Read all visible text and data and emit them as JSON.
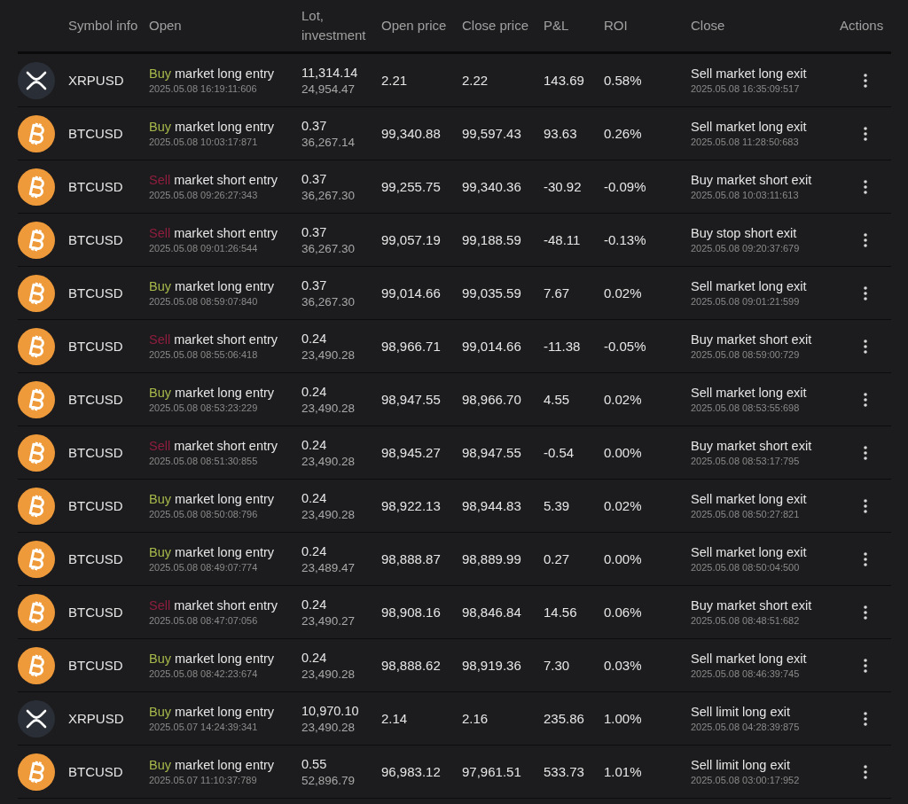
{
  "columns": [
    "Symbol info",
    "Open",
    "Lot, investment",
    "Open price",
    "Close price",
    "P&L",
    "ROI",
    "Close",
    "Actions"
  ],
  "rows": [
    {
      "kind": "xrp",
      "symbol": "XRPUSD",
      "side": {
        "label": "Buy",
        "kind": "buy"
      },
      "open_text": "market long entry",
      "open_time": "2025.05.08 16:19:11:606",
      "lot": "11,314.14",
      "investment": "24,954.47",
      "open_price": "2.21",
      "close_price": "2.22",
      "pnl": "143.69",
      "roi": "0.58%",
      "close_text": "Sell market long exit",
      "close_time": "2025.05.08 16:35:09:517"
    },
    {
      "kind": "btc",
      "symbol": "BTCUSD",
      "side": {
        "label": "Buy",
        "kind": "buy"
      },
      "open_text": "market long entry",
      "open_time": "2025.05.08 10:03:17:871",
      "lot": "0.37",
      "investment": "36,267.14",
      "open_price": "99,340.88",
      "close_price": "99,597.43",
      "pnl": "93.63",
      "roi": "0.26%",
      "close_text": "Sell market long exit",
      "close_time": "2025.05.08 11:28:50:683"
    },
    {
      "kind": "btc",
      "symbol": "BTCUSD",
      "side": {
        "label": "Sell",
        "kind": "sell"
      },
      "open_text": "market short entry",
      "open_time": "2025.05.08 09:26:27:343",
      "lot": "0.37",
      "investment": "36,267.30",
      "open_price": "99,255.75",
      "close_price": "99,340.36",
      "pnl": "-30.92",
      "roi": "-0.09%",
      "close_text": "Buy market short exit",
      "close_time": "2025.05.08 10:03:11:613"
    },
    {
      "kind": "btc",
      "symbol": "BTCUSD",
      "side": {
        "label": "Sell",
        "kind": "sell"
      },
      "open_text": "market short entry",
      "open_time": "2025.05.08 09:01:26:544",
      "lot": "0.37",
      "investment": "36,267.30",
      "open_price": "99,057.19",
      "close_price": "99,188.59",
      "pnl": "-48.11",
      "roi": "-0.13%",
      "close_text": "Buy stop short exit",
      "close_time": "2025.05.08 09:20:37:679"
    },
    {
      "kind": "btc",
      "symbol": "BTCUSD",
      "side": {
        "label": "Buy",
        "kind": "buy"
      },
      "open_text": "market long entry",
      "open_time": "2025.05.08 08:59:07:840",
      "lot": "0.37",
      "investment": "36,267.30",
      "open_price": "99,014.66",
      "close_price": "99,035.59",
      "pnl": "7.67",
      "roi": "0.02%",
      "close_text": "Sell market long exit",
      "close_time": "2025.05.08 09:01:21:599"
    },
    {
      "kind": "btc",
      "symbol": "BTCUSD",
      "side": {
        "label": "Sell",
        "kind": "sell"
      },
      "open_text": "market short entry",
      "open_time": "2025.05.08 08:55:06:418",
      "lot": "0.24",
      "investment": "23,490.28",
      "open_price": "98,966.71",
      "close_price": "99,014.66",
      "pnl": "-11.38",
      "roi": "-0.05%",
      "close_text": "Buy market short exit",
      "close_time": "2025.05.08 08:59:00:729"
    },
    {
      "kind": "btc",
      "symbol": "BTCUSD",
      "side": {
        "label": "Buy",
        "kind": "buy"
      },
      "open_text": "market long entry",
      "open_time": "2025.05.08 08:53:23:229",
      "lot": "0.24",
      "investment": "23,490.28",
      "open_price": "98,947.55",
      "close_price": "98,966.70",
      "pnl": "4.55",
      "roi": "0.02%",
      "close_text": "Sell market long exit",
      "close_time": "2025.05.08 08:53:55:698"
    },
    {
      "kind": "btc",
      "symbol": "BTCUSD",
      "side": {
        "label": "Sell",
        "kind": "sell"
      },
      "open_text": "market short entry",
      "open_time": "2025.05.08 08:51:30:855",
      "lot": "0.24",
      "investment": "23,490.28",
      "open_price": "98,945.27",
      "close_price": "98,947.55",
      "pnl": "-0.54",
      "roi": "0.00%",
      "close_text": "Buy market short exit",
      "close_time": "2025.05.08 08:53:17:795"
    },
    {
      "kind": "btc",
      "symbol": "BTCUSD",
      "side": {
        "label": "Buy",
        "kind": "buy"
      },
      "open_text": "market long entry",
      "open_time": "2025.05.08 08:50:08:796",
      "lot": "0.24",
      "investment": "23,490.28",
      "open_price": "98,922.13",
      "close_price": "98,944.83",
      "pnl": "5.39",
      "roi": "0.02%",
      "close_text": "Sell market long exit",
      "close_time": "2025.05.08 08:50:27:821"
    },
    {
      "kind": "btc",
      "symbol": "BTCUSD",
      "side": {
        "label": "Buy",
        "kind": "buy"
      },
      "open_text": "market long entry",
      "open_time": "2025.05.08 08:49:07:774",
      "lot": "0.24",
      "investment": "23,489.47",
      "open_price": "98,888.87",
      "close_price": "98,889.99",
      "pnl": "0.27",
      "roi": "0.00%",
      "close_text": "Sell market long exit",
      "close_time": "2025.05.08 08:50:04:500"
    },
    {
      "kind": "btc",
      "symbol": "BTCUSD",
      "side": {
        "label": "Sell",
        "kind": "sell"
      },
      "open_text": "market short entry",
      "open_time": "2025.05.08 08:47:07:056",
      "lot": "0.24",
      "investment": "23,490.27",
      "open_price": "98,908.16",
      "close_price": "98,846.84",
      "pnl": "14.56",
      "roi": "0.06%",
      "close_text": "Buy market short exit",
      "close_time": "2025.05.08 08:48:51:682"
    },
    {
      "kind": "btc",
      "symbol": "BTCUSD",
      "side": {
        "label": "Buy",
        "kind": "buy"
      },
      "open_text": "market long entry",
      "open_time": "2025.05.08 08:42:23:674",
      "lot": "0.24",
      "investment": "23,490.28",
      "open_price": "98,888.62",
      "close_price": "98,919.36",
      "pnl": "7.30",
      "roi": "0.03%",
      "close_text": "Sell market long exit",
      "close_time": "2025.05.08 08:46:39:745"
    },
    {
      "kind": "xrp",
      "symbol": "XRPUSD",
      "side": {
        "label": "Buy",
        "kind": "buy"
      },
      "open_text": "market long entry",
      "open_time": "2025.05.07 14:24:39:341",
      "lot": "10,970.10",
      "investment": "23,490.28",
      "open_price": "2.14",
      "close_price": "2.16",
      "pnl": "235.86",
      "roi": "1.00%",
      "close_text": "Sell limit long exit",
      "close_time": "2025.05.08 04:28:39:875"
    },
    {
      "kind": "btc",
      "symbol": "BTCUSD",
      "side": {
        "label": "Buy",
        "kind": "buy"
      },
      "open_text": "market long entry",
      "open_time": "2025.05.07 11:10:37:789",
      "lot": "0.55",
      "investment": "52,896.79",
      "open_price": "96,983.12",
      "close_price": "97,961.51",
      "pnl": "533.73",
      "roi": "1.01%",
      "close_text": "Sell limit long exit",
      "close_time": "2025.05.08 03:00:17:952"
    }
  ]
}
